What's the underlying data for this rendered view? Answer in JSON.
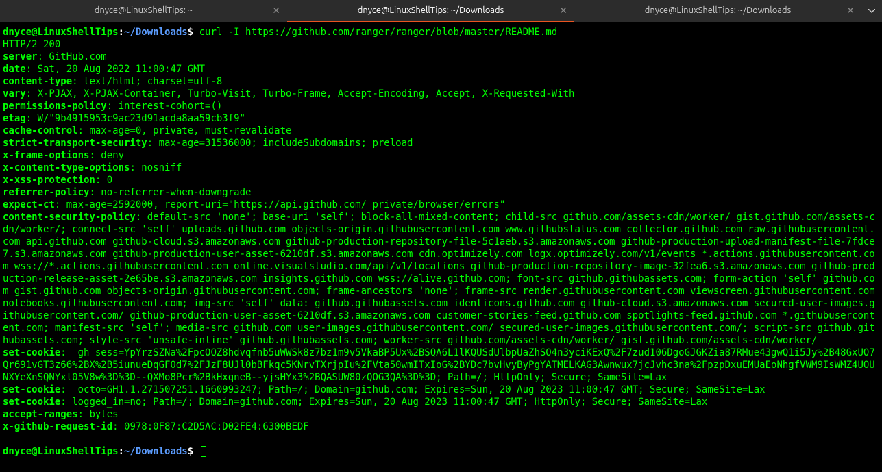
{
  "tabs": [
    {
      "label": "dnyce@LinuxShellTips: ~",
      "active": false
    },
    {
      "label": "dnyce@LinuxShellTips: ~/Downloads",
      "active": true
    },
    {
      "label": "dnyce@LinuxShellTips: ~/Downloads",
      "active": false
    }
  ],
  "prompt": {
    "user": "dnyce@LinuxShellTips",
    "colon": ":",
    "path": "~/Downloads",
    "dollar": "$"
  },
  "command": "curl -I https://github.com/ranger/ranger/blob/master/README.md",
  "status_line": "HTTP/2 200",
  "headers": [
    {
      "k": "server",
      "v": "GitHub.com"
    },
    {
      "k": "date",
      "v": "Sat, 20 Aug 2022 11:00:47 GMT"
    },
    {
      "k": "content-type",
      "v": "text/html; charset=utf-8"
    },
    {
      "k": "vary",
      "v": "X-PJAX, X-PJAX-Container, Turbo-Visit, Turbo-Frame, Accept-Encoding, Accept, X-Requested-With"
    },
    {
      "k": "permissions-policy",
      "v": "interest-cohort=()"
    },
    {
      "k": "etag",
      "v": "W/\"9b4915953c9ac23d91acda8aa59cb3f9\""
    },
    {
      "k": "cache-control",
      "v": "max-age=0, private, must-revalidate"
    },
    {
      "k": "strict-transport-security",
      "v": "max-age=31536000; includeSubdomains; preload"
    },
    {
      "k": "x-frame-options",
      "v": "deny"
    },
    {
      "k": "x-content-type-options",
      "v": "nosniff"
    },
    {
      "k": "x-xss-protection",
      "v": "0"
    },
    {
      "k": "referrer-policy",
      "v": "no-referrer-when-downgrade"
    },
    {
      "k": "expect-ct",
      "v": "max-age=2592000, report-uri=\"https://api.github.com/_private/browser/errors\""
    },
    {
      "k": "content-security-policy",
      "v": "default-src 'none'; base-uri 'self'; block-all-mixed-content; child-src github.com/assets-cdn/worker/ gist.github.com/assets-cdn/worker/; connect-src 'self' uploads.github.com objects-origin.githubusercontent.com www.githubstatus.com collector.github.com raw.githubusercontent.com api.github.com github-cloud.s3.amazonaws.com github-production-repository-file-5c1aeb.s3.amazonaws.com github-production-upload-manifest-file-7fdce7.s3.amazonaws.com github-production-user-asset-6210df.s3.amazonaws.com cdn.optimizely.com logx.optimizely.com/v1/events *.actions.githubusercontent.com wss://*.actions.githubusercontent.com online.visualstudio.com/api/v1/locations github-production-repository-image-32fea6.s3.amazonaws.com github-production-release-asset-2e65be.s3.amazonaws.com insights.github.com wss://alive.github.com; font-src github.githubassets.com; form-action 'self' github.com gist.github.com objects-origin.githubusercontent.com; frame-ancestors 'none'; frame-src render.githubusercontent.com viewscreen.githubusercontent.com notebooks.githubusercontent.com; img-src 'self' data: github.githubassets.com identicons.github.com github-cloud.s3.amazonaws.com secured-user-images.githubusercontent.com/ github-production-user-asset-6210df.s3.amazonaws.com customer-stories-feed.github.com spotlights-feed.github.com *.githubusercontent.com; manifest-src 'self'; media-src github.com user-images.githubusercontent.com/ secured-user-images.githubusercontent.com/; script-src github.githubassets.com; style-src 'unsafe-inline' github.githubassets.com; worker-src github.com/assets-cdn/worker/ gist.github.com/assets-cdn/worker/"
    },
    {
      "k": "set-cookie",
      "v": "_gh_sess=YpYrzSZNa%2FpcOQZ8hdvqfnb5uWWSk8z7bz1m9v5VkaBP5Ux%2BSQA6L1lKQUSdUlbpUaZhSO4n3yciKExQ%2F7zud106DgoGJGKZia87RMue43gwQ1i5Jy%2B48GxUO7Qr691vGT3z66%2BX%2B5iunueDqGF0d7%2FJzF8UJl0bBFkqc5KNrvTXrjpIu%2FVta50wmITxIoG%2BYDc7bvHvyByPgYATMELKAG3Awnwux7jcJvhc3na%2FpzpDxuEMUaEoNhgfVWM9IsWMZ4UOUNXYeXnSQNYxl05V8w%3D%3D--QXMo8Pcr%2BkHxqneB--yjsHYx3%2BQASUW80zQOG3QA%3D%3D; Path=/; HttpOnly; Secure; SameSite=Lax"
    },
    {
      "k": "set-cookie",
      "v": "_octo=GH1.1.271507251.1660993247; Path=/; Domain=github.com; Expires=Sun, 20 Aug 2023 11:00:47 GMT; Secure; SameSite=Lax"
    },
    {
      "k": "set-cookie",
      "v": "logged_in=no; Path=/; Domain=github.com; Expires=Sun, 20 Aug 2023 11:00:47 GMT; HttpOnly; Secure; SameSite=Lax"
    },
    {
      "k": "accept-ranges",
      "v": "bytes"
    },
    {
      "k": "x-github-request-id",
      "v": "0978:0F87:C2D5AC:D02FE4:6300BEDF"
    }
  ]
}
